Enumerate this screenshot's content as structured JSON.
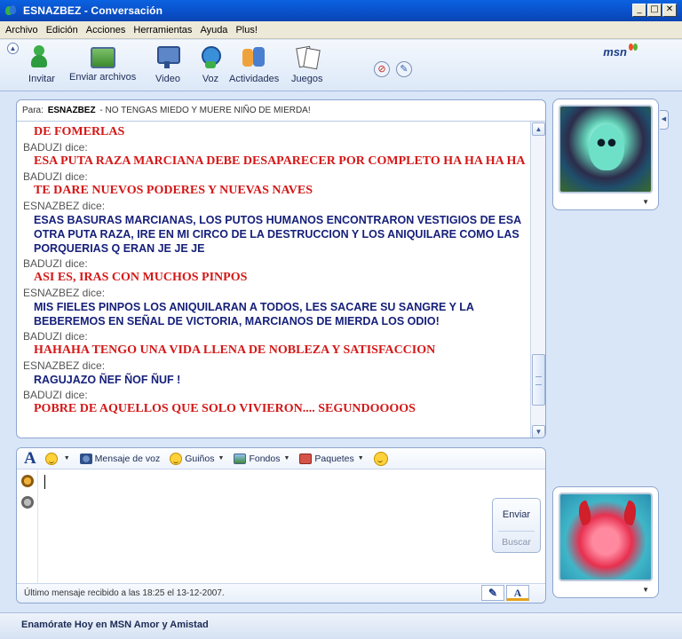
{
  "window": {
    "title": "ESNAZBEZ - Conversación"
  },
  "menu": [
    "Archivo",
    "Edición",
    "Acciones",
    "Herramientas",
    "Ayuda",
    "Plus!"
  ],
  "toolbar": {
    "items": [
      {
        "label": "Invitar",
        "icon": "invite-buddy-icon"
      },
      {
        "label": "Enviar archivos",
        "icon": "send-files-icon"
      },
      {
        "label": "Video",
        "icon": "video-icon"
      },
      {
        "label": "Voz",
        "icon": "voice-icon"
      },
      {
        "label": "Actividades",
        "icon": "activities-icon"
      },
      {
        "label": "Juegos",
        "icon": "games-icon"
      }
    ],
    "logo": "msn"
  },
  "conversation": {
    "to_label": "Para:",
    "to_name": "ESNAZBEZ",
    "to_status": "- NO TENGAS MIEDO Y MUERE NIÑO DE MIERDA!",
    "messages": [
      {
        "sender": "",
        "text": "DE FOMERLAS",
        "style": "baduzi"
      },
      {
        "sender": "BADUZI dice:",
        "text": "ESA PUTA RAZA MARCIANA DEBE DESAPARECER POR COMPLETO HA HA HA HA",
        "style": "baduzi"
      },
      {
        "sender": "BADUZI dice:",
        "text": "TE DARE NUEVOS PODERES Y NUEVAS NAVES",
        "style": "baduzi"
      },
      {
        "sender": "ESNAZBEZ dice:",
        "text": "ESAS BASURAS MARCIANAS, LOS PUTOS HUMANOS ENCONTRARON VESTIGIOS DE ESA OTRA PUTA RAZA, IRE EN MI CIRCO DE LA DESTRUCCION Y LOS ANIQUILARE COMO LAS PORQUERIAS Q ERAN JE JE JE",
        "style": "esnaz"
      },
      {
        "sender": "BADUZI dice:",
        "text": "ASI ES, IRAS CON MUCHOS PINPOS",
        "style": "baduzi"
      },
      {
        "sender": "ESNAZBEZ dice:",
        "text": "MIS FIELES PINPOS LOS ANIQUILARAN A TODOS, LES SACARE SU SANGRE Y LA BEBEREMOS EN SEÑAL DE VICTORIA, MARCIANOS DE MIERDA LOS ODIO!",
        "style": "esnaz"
      },
      {
        "sender": "BADUZI dice:",
        "text": "HAHAHA TENGO UNA VIDA LLENA DE NOBLEZA Y SATISFACCION",
        "style": "baduzi"
      },
      {
        "sender": "ESNAZBEZ dice:",
        "text": "RAGUJAZO ÑEF ÑOF ÑUF !",
        "style": "esnaz"
      },
      {
        "sender": "BADUZI dice:",
        "text": "POBRE DE AQUELLOS QUE SOLO VIVIERON.... SEGUNDOOOOS",
        "style": "baduzi"
      }
    ]
  },
  "compose": {
    "font_glyph": "A",
    "voice_clip": "Mensaje de voz",
    "winks": "Guiños",
    "backgrounds": "Fondos",
    "packages": "Paquetes",
    "send": "Enviar",
    "find": "Buscar",
    "status": "Último mensaje recibido a las 18:25 el 13-12-2007.",
    "mode_text": "A"
  },
  "footer": {
    "ad": "Enamórate Hoy en MSN Amor y Amistad"
  },
  "colors": {
    "sender_baduzi": "#d41717",
    "sender_esnaz": "#16207a",
    "titlebar": "#0a4fc8"
  }
}
